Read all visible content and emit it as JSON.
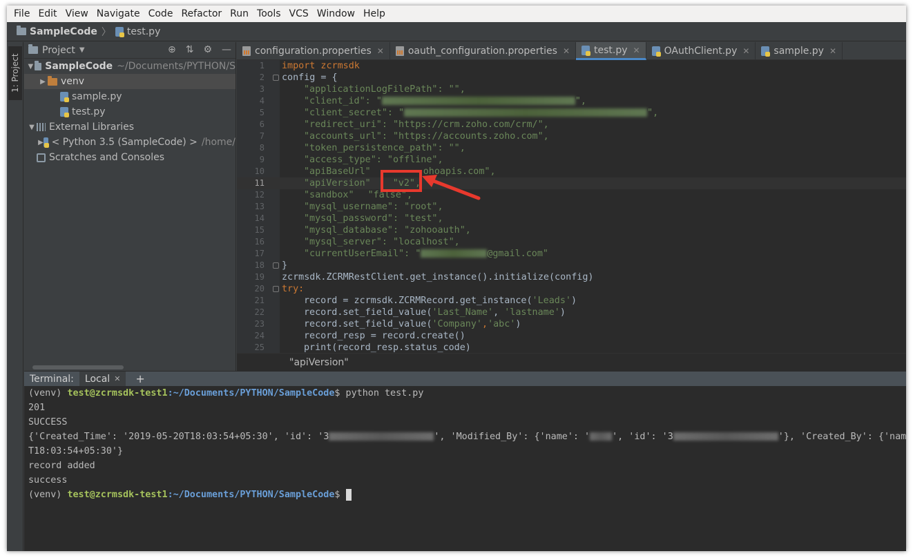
{
  "menu": [
    "File",
    "Edit",
    "View",
    "Navigate",
    "Code",
    "Refactor",
    "Run",
    "Tools",
    "VCS",
    "Window",
    "Help"
  ],
  "navbar": {
    "project": "SampleCode",
    "file": "test.py"
  },
  "stripe": {
    "label": "1: Project"
  },
  "project_panel": {
    "title": "Project",
    "tree": [
      {
        "name": "SampleCode",
        "path": "~/Documents/PYTHON/S"
      },
      {
        "name": "venv"
      },
      {
        "name": "sample.py"
      },
      {
        "name": "test.py"
      },
      {
        "name": "External Libraries"
      },
      {
        "name": "< Python 3.5 (SampleCode) >",
        "path": "/home/"
      },
      {
        "name": "Scratches and Consoles"
      }
    ]
  },
  "editor": {
    "tabs": [
      "configuration.properties",
      "oauth_configuration.properties",
      "test.py",
      "OAuthClient.py",
      "sample.py"
    ],
    "active_tab": "test.py",
    "line_numbers": [
      "1",
      "2",
      "3",
      "4",
      "5",
      "6",
      "7",
      "8",
      "9",
      "10",
      "11",
      "12",
      "13",
      "14",
      "15",
      "16",
      "17",
      "18",
      "19",
      "20",
      "21",
      "22",
      "23",
      "24",
      "25"
    ],
    "code": {
      "l1": "import zcrmsdk",
      "l2": "config = {",
      "l3": "\"applicationLogFilePath\": \"\",",
      "l4a": "\"client_id\": \"",
      "l4b": "\",",
      "l5a": "\"client_secret\": \"",
      "l5b": "\",",
      "l6": "\"redirect_uri\": \"https://crm.zoho.com/crm/\",",
      "l7": "\"accounts_url\": \"https://accounts.zoho.com\",",
      "l8": "\"token_persistence_path\": \"\",",
      "l9": "\"access_type\": \"offline\",",
      "l10a": "\"apiBaseUrl\"",
      "l10b": "ohoapis.com\",",
      "l11a": "\"apiVersion\"",
      "l11b": "\"v2\",",
      "l12a": "\"sandbox\"",
      "l12b": "\"false\",",
      "l13": "\"mysql_username\": \"root\",",
      "l14": "\"mysql_password\": \"test\",",
      "l15": "\"mysql_database\": \"zohooauth\",",
      "l16": "\"mysql_server\": \"localhost\",",
      "l17a": "\"currentUserEmail\": \"",
      "l17b": "@gmail.com\"",
      "l18": "}",
      "l19": "zcrmsdk.ZCRMRestClient.get_instance().initialize(config)",
      "l20": "try:",
      "l21a": "record = zcrmsdk.ZCRMRecord.get_instance(",
      "l21b": "'Leads'",
      "l21c": ")",
      "l22a": "record.set_field_value(",
      "l22b": "'Last_Name'",
      "l22c": ", ",
      "l22d": "'lastname'",
      "l22e": ")",
      "l23a": "record.set_field_value(",
      "l23b": "'Company'",
      "l23c": ",",
      "l23d": "'abc'",
      "l23e": ")",
      "l24": "record_resp = record.create()",
      "l25": "print(record_resp.status_code)"
    },
    "bottom_breadcrumb": "\"apiVersion\""
  },
  "terminal": {
    "label": "Terminal:",
    "tab": "Local",
    "prompt_env": "(venv) ",
    "prompt_user": "test@zcrmsdk-test1",
    "prompt_path": ":~/Documents/PYTHON/SampleCode",
    "prompt_end": "$ ",
    "command": "python test.py",
    "out1": "201",
    "out2": "SUCCESS",
    "out3a": "{'Created_Time': '2019-05-20T18:03:54+05:30', 'id': '3",
    "out3b": "', 'Modified_By': {'name': '",
    "out3c": "', 'id': '3",
    "out3d": "'}, 'Created_By': {'name':",
    "out4": "T18:03:54+05:30'}",
    "out5": "record added",
    "out6": "success"
  },
  "colors": {
    "accent": "#4a88c7",
    "highlight": "#e8392d"
  }
}
